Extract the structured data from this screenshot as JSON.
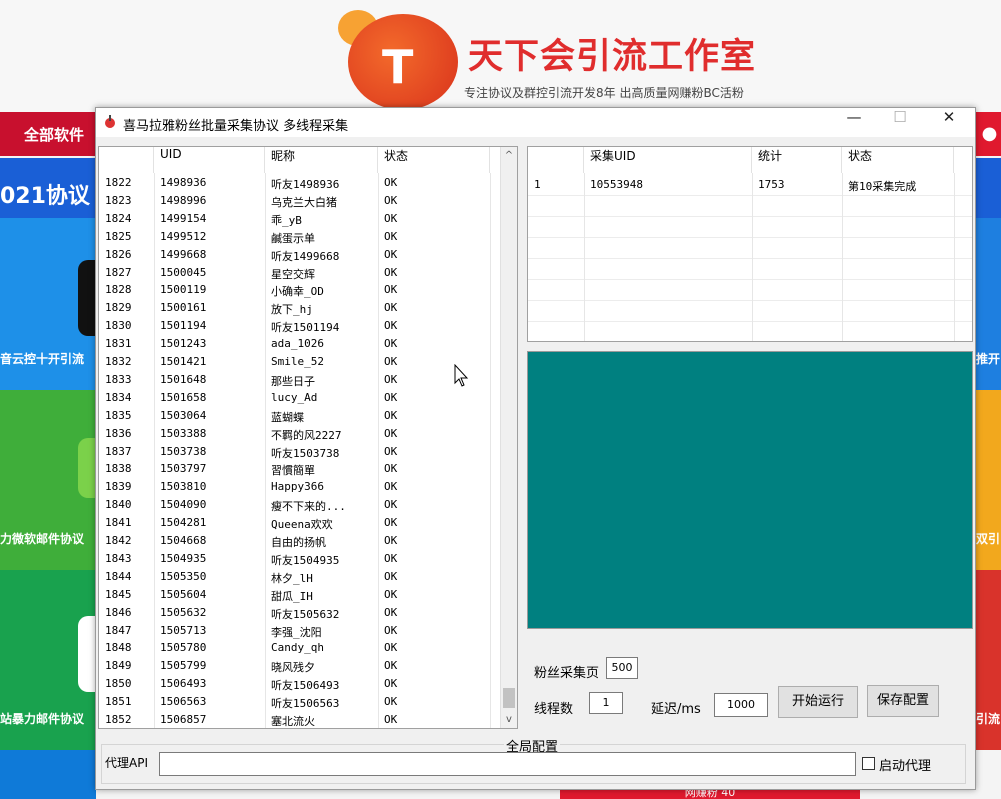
{
  "background": {
    "brand_title": "天下会引流工作室",
    "brand_subtitle": "专注协议及群控引流开发8年 出高质量网赚粉BC活粉",
    "logo_letter": "T",
    "nav_label": "全部软件",
    "left_tiles": [
      "021协议",
      "音云控十开引流",
      "力微软邮件协议",
      "站暴力邮件协议"
    ],
    "right_tiles": [
      "推开",
      "双引",
      "引流"
    ],
    "bottom_label": "网赚粉 40"
  },
  "window": {
    "title": "喜马拉雅粉丝批量采集协议 多线程采集",
    "minimize_glyph": "—",
    "maximize_glyph": "☐",
    "close_glyph": "✕"
  },
  "left_list": {
    "headers": [
      "UID",
      "昵称",
      "状态"
    ],
    "rows": [
      [
        "1822",
        "1498936",
        "听友1498936",
        "OK"
      ],
      [
        "1823",
        "1498996",
        "乌克兰大白猪",
        "OK"
      ],
      [
        "1824",
        "1499154",
        "乖_yB",
        "OK"
      ],
      [
        "1825",
        "1499512",
        "鹹蛋示单",
        "OK"
      ],
      [
        "1826",
        "1499668",
        "听友1499668",
        "OK"
      ],
      [
        "1827",
        "1500045",
        "星空交辉",
        "OK"
      ],
      [
        "1828",
        "1500119",
        "小确幸_OD",
        "OK"
      ],
      [
        "1829",
        "1500161",
        "放下_hj",
        "OK"
      ],
      [
        "1830",
        "1501194",
        "听友1501194",
        "OK"
      ],
      [
        "1831",
        "1501243",
        "ada_1026",
        "OK"
      ],
      [
        "1832",
        "1501421",
        "Smile_52",
        "OK"
      ],
      [
        "1833",
        "1501648",
        "那些日子",
        "OK"
      ],
      [
        "1834",
        "1501658",
        "lucy_Ad",
        "OK"
      ],
      [
        "1835",
        "1503064",
        "蓝蝴蝶",
        "OK"
      ],
      [
        "1836",
        "1503388",
        "不羁的风2227",
        "OK"
      ],
      [
        "1837",
        "1503738",
        "听友1503738",
        "OK"
      ],
      [
        "1838",
        "1503797",
        "習慣簡單",
        "OK"
      ],
      [
        "1839",
        "1503810",
        "Happy366",
        "OK"
      ],
      [
        "1840",
        "1504090",
        "瘦不下来的...",
        "OK"
      ],
      [
        "1841",
        "1504281",
        "Queena欢欢",
        "OK"
      ],
      [
        "1842",
        "1504668",
        "自由的扬帆",
        "OK"
      ],
      [
        "1843",
        "1504935",
        "听友1504935",
        "OK"
      ],
      [
        "1844",
        "1505350",
        "林夕_lH",
        "OK"
      ],
      [
        "1845",
        "1505604",
        "甜瓜_IH",
        "OK"
      ],
      [
        "1846",
        "1505632",
        "听友1505632",
        "OK"
      ],
      [
        "1847",
        "1505713",
        "李强_沈阳",
        "OK"
      ],
      [
        "1848",
        "1505780",
        "Candy_qh",
        "OK"
      ],
      [
        "1849",
        "1505799",
        "晓风残夕",
        "OK"
      ],
      [
        "1850",
        "1506493",
        "听友1506493",
        "OK"
      ],
      [
        "1851",
        "1506563",
        "听友1506563",
        "OK"
      ],
      [
        "1852",
        "1506857",
        "塞北流火",
        "OK"
      ]
    ],
    "scroll_up": "^",
    "scroll_down": "v"
  },
  "right_list": {
    "headers": [
      "采集UID",
      "统计",
      "状态"
    ],
    "rows": [
      [
        "1",
        "10553948",
        "1753",
        "第10采集完成"
      ]
    ]
  },
  "config": {
    "fans_page_label": "粉丝采集页",
    "fans_page_value": "500",
    "threads_label": "线程数",
    "threads_value": "1",
    "delay_label": "延迟/ms",
    "delay_value": "1000",
    "start_button": "开始运行",
    "save_button": "保存配置",
    "group_title": "全局配置",
    "proxy_api_label": "代理API",
    "proxy_api_value": "",
    "proxy_checkbox_label": "启动代理"
  },
  "colors": {
    "teal_panel": "#008080",
    "brand_red": "#e02d2d",
    "nav_red": "#e0192e"
  }
}
